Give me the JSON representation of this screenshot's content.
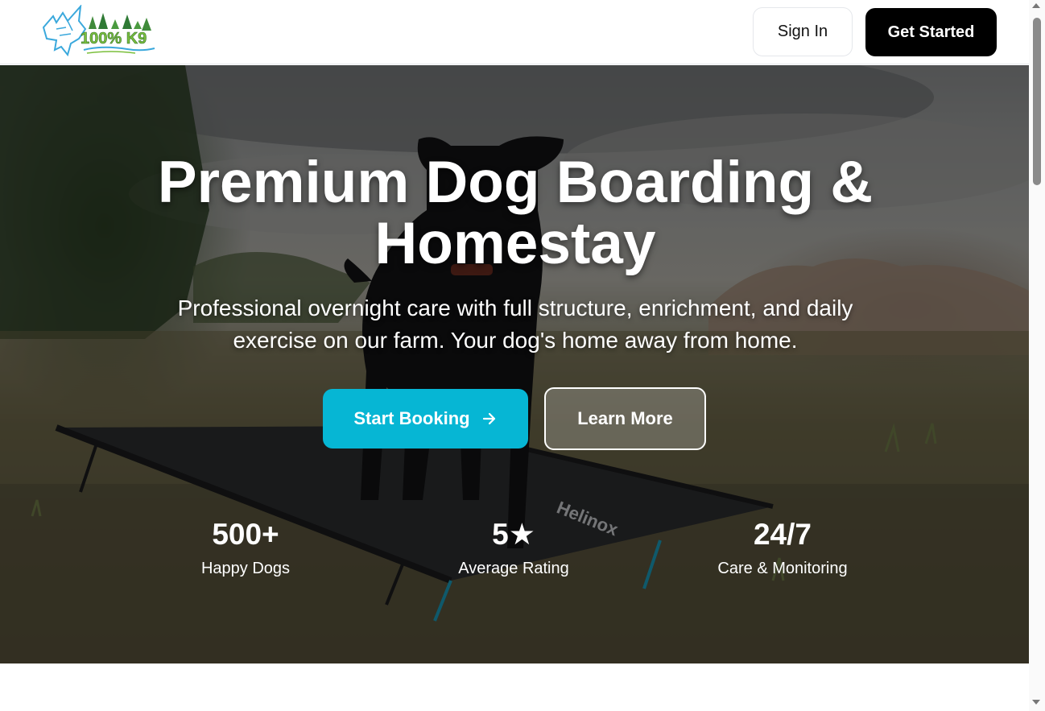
{
  "header": {
    "logo_text": "100% K9",
    "sign_in_label": "Sign In",
    "get_started_label": "Get Started"
  },
  "hero": {
    "title": "Premium Dog Boarding & Homestay",
    "subtitle": "Professional overnight care with full structure, enrichment, and daily exercise on our farm. Your dog's home away from home.",
    "primary_cta": {
      "label": "Start Booking",
      "icon": "arrow-right-icon"
    },
    "secondary_cta": {
      "label": "Learn More"
    },
    "cot_brand": "Helinox",
    "stats": [
      {
        "value": "500+",
        "label": "Happy Dogs"
      },
      {
        "value": "5★",
        "label": "Average Rating"
      },
      {
        "value": "24/7",
        "label": "Care & Monitoring"
      }
    ]
  },
  "colors": {
    "accent": "#06b6d4",
    "primary_button": "#000000",
    "logo_blue": "#3aa8dc",
    "logo_green": "#7bbf3c"
  }
}
